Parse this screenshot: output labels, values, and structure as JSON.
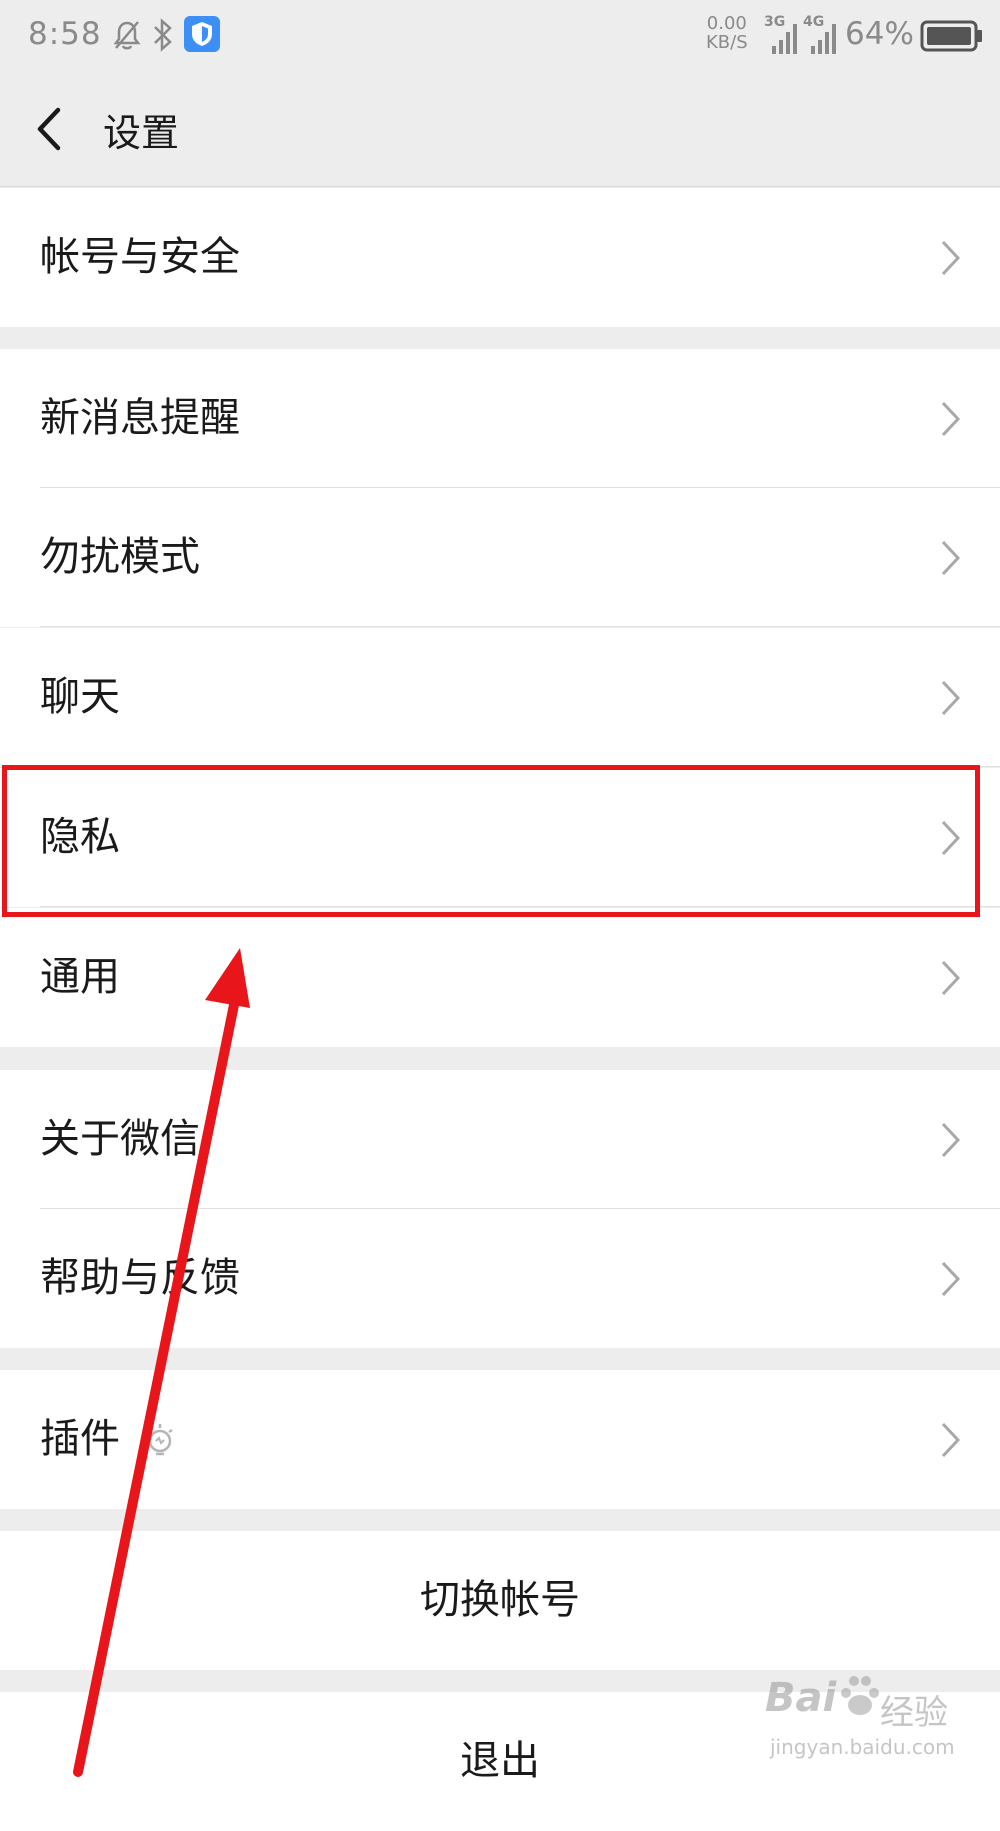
{
  "status_bar": {
    "time": "8:58",
    "net_speed_value": "0.00",
    "net_speed_unit": "KB/S",
    "network_3g": "3G",
    "network_4g": "4G",
    "battery_percent": "64%",
    "icons": [
      "mute-bell-icon",
      "bluetooth-icon",
      "shield-app-icon",
      "signal-icon",
      "battery-icon"
    ]
  },
  "header": {
    "title": "设置"
  },
  "settings": {
    "account_security": "帐号与安全",
    "new_message_alert": "新消息提醒",
    "do_not_disturb": "勿扰模式",
    "chat": "聊天",
    "privacy": "隐私",
    "general": "通用",
    "about_wechat": "关于微信",
    "help_feedback": "帮助与反馈",
    "plugins": "插件",
    "switch_account": "切换帐号",
    "logout": "退出"
  },
  "annotation": {
    "highlight_color": "#e8161b",
    "highlighted_item": "隐私"
  },
  "watermark": {
    "brand": "Bai",
    "brand2": "经验",
    "url": "jingyan.baidu.com"
  },
  "colors": {
    "background": "#ededed",
    "row": "#ffffff",
    "text": "#1a1a1a",
    "status_text": "#8a8a8a",
    "accent_red": "#e8161b"
  }
}
